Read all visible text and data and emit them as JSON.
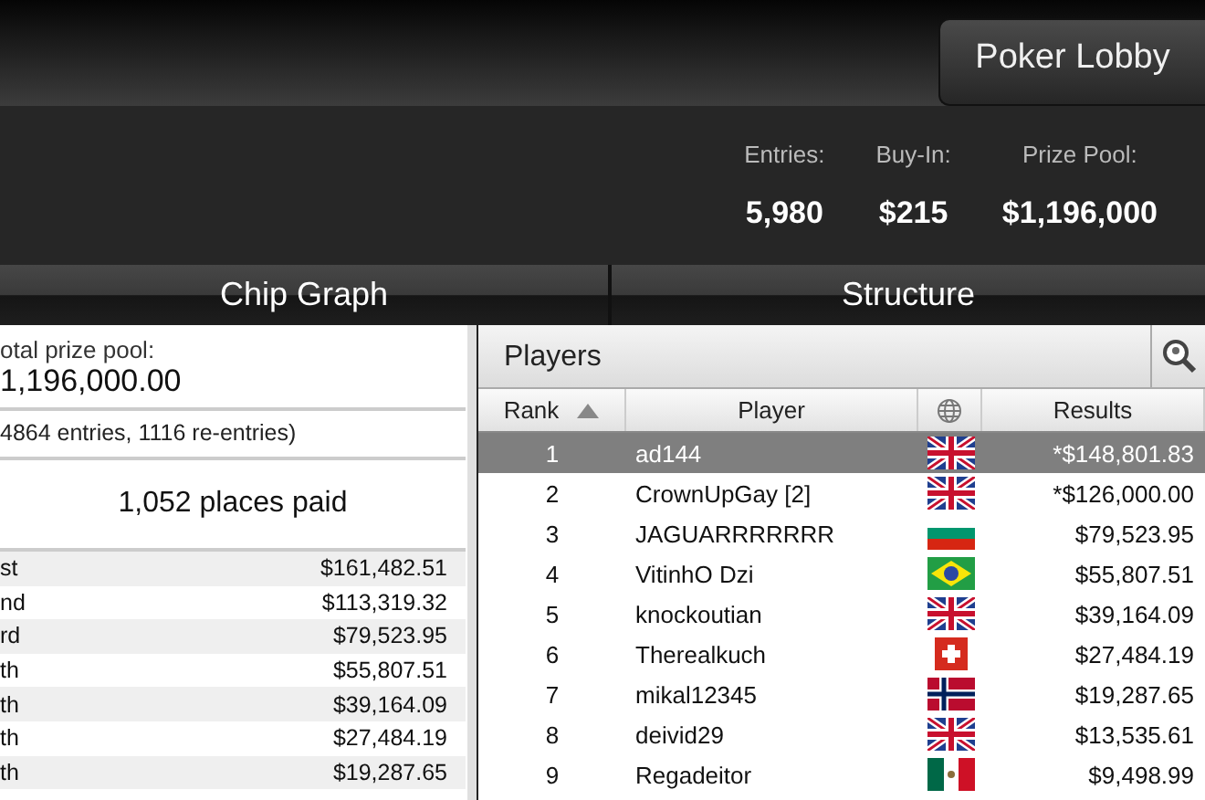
{
  "header": {
    "button": "Poker Lobby"
  },
  "stats": [
    {
      "label": "Entries:",
      "value": "5,980"
    },
    {
      "label": "Buy-In:",
      "value": "$215"
    },
    {
      "label": "Prize Pool:",
      "value": "$1,196,000"
    }
  ],
  "tabs": [
    {
      "label": "Chip Graph"
    },
    {
      "label": "Structure"
    }
  ],
  "prizes": {
    "pool_label": "otal prize pool:",
    "pool_value": "1,196,000.00",
    "entries_note": "4864 entries, 1116 re-entries)",
    "places_paid": "1,052 places paid",
    "rows": [
      {
        "place": "st",
        "amount": "$161,482.51"
      },
      {
        "place": "nd",
        "amount": "$113,319.32"
      },
      {
        "place": "rd",
        "amount": "$79,523.95"
      },
      {
        "place": "th",
        "amount": "$55,807.51"
      },
      {
        "place": "th",
        "amount": "$39,164.09"
      },
      {
        "place": "th",
        "amount": "$27,484.19"
      },
      {
        "place": "th",
        "amount": "$19,287.65"
      }
    ]
  },
  "players": {
    "title": "Players",
    "columns": [
      "Rank",
      "Player",
      "Results"
    ],
    "rows": [
      {
        "rank": "1",
        "name": "ad144",
        "kind": "gb",
        "result": "*$148,801.83",
        "selected": true
      },
      {
        "rank": "2",
        "name": "CrownUpGay [2]",
        "kind": "gb",
        "result": "*$126,000.00",
        "selected": false
      },
      {
        "rank": "3",
        "name": "JAGUARRRRRRR",
        "kind": "bg",
        "result": "$79,523.95",
        "selected": false
      },
      {
        "rank": "4",
        "name": "VitinhO Dzi",
        "kind": "br",
        "result": "$55,807.51",
        "selected": false
      },
      {
        "rank": "5",
        "name": "knockoutian",
        "kind": "gb",
        "result": "$39,164.09",
        "selected": false
      },
      {
        "rank": "6",
        "name": "Therealkuch",
        "kind": "ch",
        "result": "$27,484.19",
        "selected": false
      },
      {
        "rank": "7",
        "name": "mikal12345",
        "kind": "no",
        "result": "$19,287.65",
        "selected": false
      },
      {
        "rank": "8",
        "name": "deivid29",
        "kind": "gb",
        "result": "$13,535.61",
        "selected": false
      },
      {
        "rank": "9",
        "name": "Regadeitor",
        "kind": "mx",
        "result": "$9,498.99",
        "selected": false
      }
    ]
  }
}
